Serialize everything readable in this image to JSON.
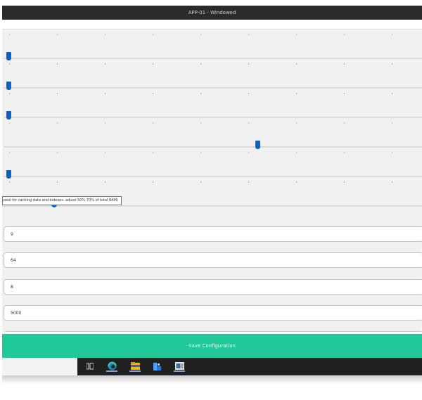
{
  "window": {
    "title": "APP-01 - Windowed"
  },
  "sliders": [
    {
      "name": "slider-1",
      "value_fraction": 0.0
    },
    {
      "name": "slider-2",
      "value_fraction": 0.0
    },
    {
      "name": "slider-3",
      "value_fraction": 0.0
    },
    {
      "name": "slider-4",
      "value_fraction": 0.61
    },
    {
      "name": "slider-5",
      "value_fraction": 0.0
    },
    {
      "name": "slider-6",
      "value_fraction": 0.11
    }
  ],
  "tooltip": {
    "text": "pool for caching data and indexes. adjust 50%-70% of total RAM)"
  },
  "fields": [
    {
      "name": "field-1",
      "value": "9"
    },
    {
      "name": "field-2",
      "value": "64"
    },
    {
      "name": "field-3",
      "value": "8"
    },
    {
      "name": "field-4",
      "value": "5000"
    }
  ],
  "actions": {
    "save_label": "Save Configuration"
  },
  "taskbar": {
    "icons": [
      "task-view-icon",
      "edge-browser-icon",
      "file-explorer-icon",
      "network-app-icon",
      "terminal-app-icon"
    ]
  },
  "colors": {
    "accent": "#20c997",
    "thumb": "#0b63c8",
    "titlebar": "#2b2b2b",
    "taskbar": "#202020"
  }
}
